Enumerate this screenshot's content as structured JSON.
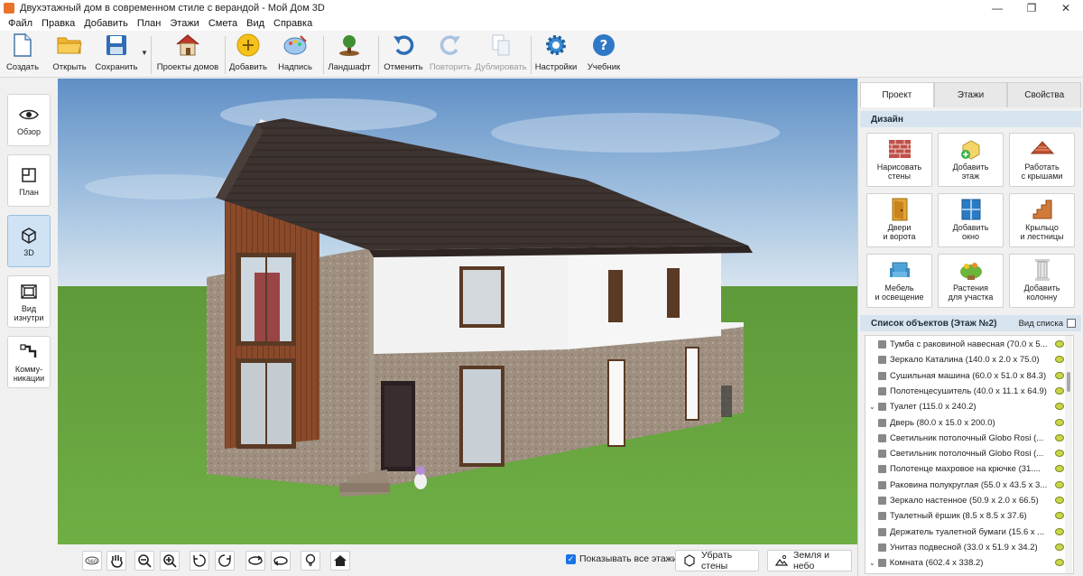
{
  "window": {
    "title": "Двухэтажный дом в современном стиле с верандой - Мой Дом 3D",
    "minimize": "—",
    "maximize": "❐",
    "close": "✕"
  },
  "menu": [
    "Файл",
    "Правка",
    "Добавить",
    "План",
    "Этажи",
    "Смета",
    "Вид",
    "Справка"
  ],
  "toolbar": {
    "create": "Создать",
    "open": "Открыть",
    "save": "Сохранить",
    "save_dropdown": "▼",
    "house_projects": "Проекты домов",
    "add": "Добавить",
    "label": "Надпись",
    "landscape": "Ландшафт",
    "undo": "Отменить",
    "redo": "Повторить",
    "duplicate": "Дублировать",
    "settings": "Настройки",
    "tutorial": "Учебник"
  },
  "leftnav": {
    "overview": "Обзор",
    "plan": "План",
    "view3d": "3D",
    "inside": "Вид\nизнутри",
    "utilities": "Комму-\nникации"
  },
  "bottombar": {
    "show_all_floors": "Показывать все этажи",
    "remove_walls": "Убрать стены",
    "ground_sky": "Земля и небо"
  },
  "rpanel": {
    "tabs": [
      "Проект",
      "Этажи",
      "Свойства"
    ],
    "design_header": "Дизайн",
    "tiles": [
      "Нарисовать\nстены",
      "Добавить\nэтаж",
      "Работать\nс крышами",
      "Двери\nи ворота",
      "Добавить\nокно",
      "Крыльцо\nи лестницы",
      "Мебель\nи освещение",
      "Растения\nдля участка",
      "Добавить\nколонну"
    ],
    "objlist_header": "Список объектов (Этаж №2)",
    "objlist_view": "Вид списка",
    "objects": [
      {
        "name": "Тумба с раковиной навесная",
        "dims": "(70.0 x 5...",
        "toggle": ""
      },
      {
        "name": "Зеркало Каталина",
        "dims": "(140.0 x 2.0 x 75.0)",
        "toggle": ""
      },
      {
        "name": "Сушильная машина",
        "dims": "(60.0 x 51.0 x 84.3)",
        "toggle": ""
      },
      {
        "name": "Полотенцесушитель",
        "dims": "(40.0 x 11.1 x 64.9)",
        "toggle": ""
      },
      {
        "name": "Туалет",
        "dims": "(115.0 x 240.2)",
        "toggle": "⌄"
      },
      {
        "name": "Дверь",
        "dims": "(80.0 x 15.0 x 200.0)",
        "toggle": ""
      },
      {
        "name": "Светильник потолочный Globo Rosi",
        "dims": "(...",
        "toggle": ""
      },
      {
        "name": "Светильник потолочный Globo Rosi",
        "dims": "(...",
        "toggle": ""
      },
      {
        "name": "Полотенце махровое на крючке",
        "dims": "(31....",
        "toggle": ""
      },
      {
        "name": "Раковина полукруглая",
        "dims": "(55.0 x 43.5 x 3...",
        "toggle": ""
      },
      {
        "name": "Зеркало настенное",
        "dims": "(50.9 x 2.0 x 66.5)",
        "toggle": ""
      },
      {
        "name": "Туалетный ёршик",
        "dims": "(8.5 x 8.5 x 37.6)",
        "toggle": ""
      },
      {
        "name": "Держатель туалетной бумаги",
        "dims": "(15.6 x ...",
        "toggle": ""
      },
      {
        "name": "Унитаз подвесной",
        "dims": "(33.0 x 51.9 x 34.2)",
        "toggle": ""
      },
      {
        "name": "Комната",
        "dims": "(602.4 x 338.2)",
        "toggle": "⌄"
      }
    ]
  }
}
